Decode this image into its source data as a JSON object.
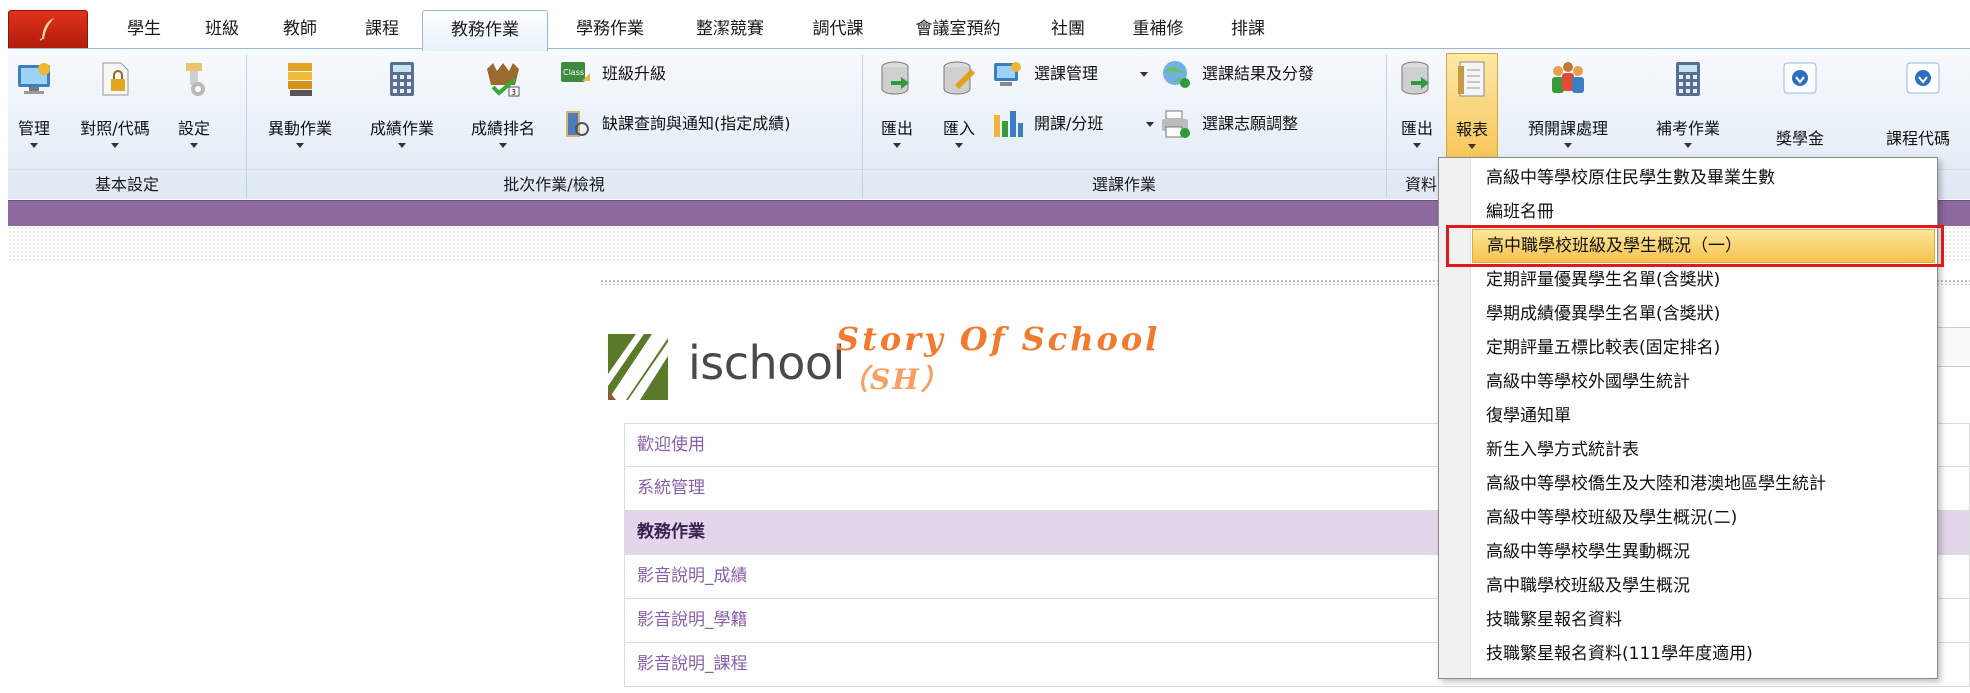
{
  "tabs": [
    "學生",
    "班級",
    "教師",
    "課程",
    "教務作業",
    "學務作業",
    "整潔競賽",
    "調代課",
    "會議室預約",
    "社團",
    "重補修",
    "排課"
  ],
  "active_tab": "教務作業",
  "ribbon": {
    "basic": {
      "label": "基本設定",
      "buttons": [
        "管理",
        "對照/代碼",
        "設定"
      ]
    },
    "batch": {
      "label": "批次作業/檢視",
      "buttons": [
        "異動作業",
        "成績作業",
        "成績排名"
      ],
      "small": [
        "班級升級",
        "缺課查詢與通知(指定成績)"
      ]
    },
    "course_select": {
      "label": "選課作業",
      "buttons": [
        "匯出",
        "匯入"
      ],
      "small": [
        "選課管理",
        "開課/分班",
        "選課結果及分發",
        "選課志願調整"
      ]
    },
    "data": {
      "label": "資料",
      "buttons": [
        "匯出",
        "報表"
      ]
    },
    "others": [
      "預開課處理",
      "補考作業",
      "獎學金",
      "課程代碼"
    ]
  },
  "icons": {
    "app_orb": "feather-icon",
    "manage": "computer-icon",
    "mapping": "lock-document-icon",
    "settings": "settings-icon",
    "transfer": "books-icon",
    "score": "calculator-icon",
    "rank": "ranking-icon",
    "upgrade": "class-upgrade-icon",
    "absence": "absence-query-icon",
    "db_export": "database-export-icon",
    "db_import": "database-import-icon",
    "course_manage": "course-manage-icon",
    "open_course": "bar-chart-icon",
    "result": "globe-icon",
    "adjust": "printer-icon",
    "report": "report-icon",
    "pre_course": "people-icon",
    "makeup": "calculator-icon",
    "scholarship": "scholarship-icon",
    "course_code": "course-code-icon"
  },
  "logo": {
    "text": "ischool",
    "tagline": "Story Of School",
    "sub": "（SH）"
  },
  "nav": [
    {
      "label": "歡迎使用",
      "selected": false
    },
    {
      "label": "系統管理",
      "selected": false
    },
    {
      "label": "教務作業",
      "selected": true
    },
    {
      "label": "影音說明_成績",
      "selected": false
    },
    {
      "label": "影音說明_學籍",
      "selected": false
    },
    {
      "label": "影音說明_課程",
      "selected": false
    }
  ],
  "report_menu": {
    "items": [
      "高級中等學校原住民學生數及畢業生數",
      "編班名冊",
      "高中職學校班級及學生概況（一）",
      "定期評量優異學生名單(含獎狀)",
      "學期成績優異學生名單(含獎狀)",
      "定期評量五標比較表(固定排名)",
      "高級中等學校外國學生統計",
      "復學通知單",
      "新生入學方式統計表",
      "高級中等學校僑生及大陸和港澳地區學生統計",
      "高級中等學校班級及學生概況(二)",
      "高級中等學校學生異動概況",
      "高中職學校班級及學生概況",
      "技職繁星報名資料",
      "技職繁星報名資料(111學年度適用)"
    ],
    "highlighted": "高中職學校班級及學生概況（一）"
  },
  "colors": {
    "band": "#8c6a9f",
    "highlight": "#f6c24e",
    "annotation": "#e0191b",
    "nav_text": "#8a5fa8",
    "tagline": "#f27a2e"
  }
}
